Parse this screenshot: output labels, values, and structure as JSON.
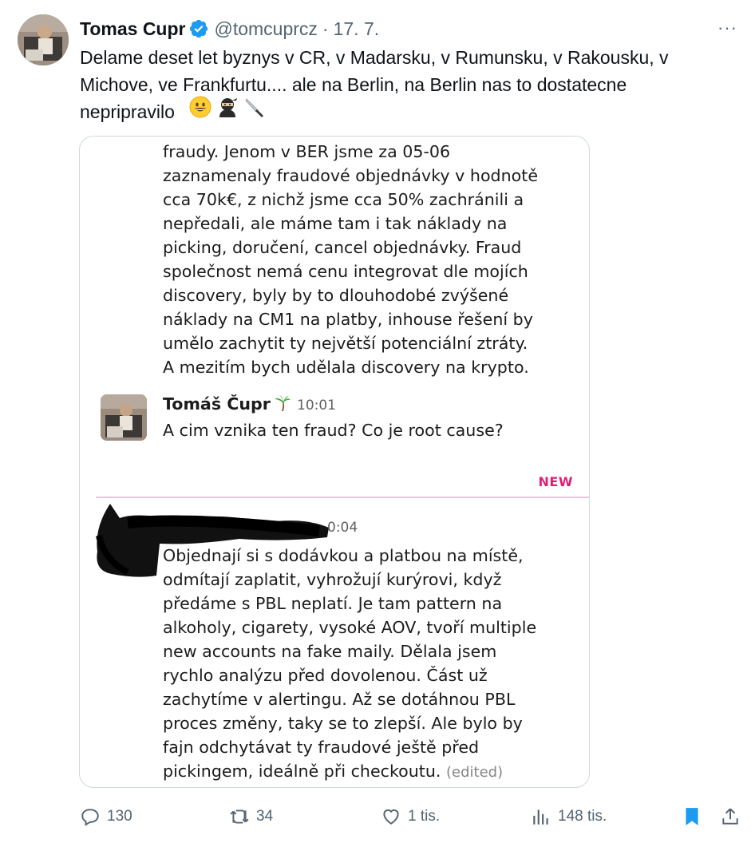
{
  "author": {
    "name": "Tomas Cupr",
    "handle": "@tomcuprcz",
    "separator": "·",
    "date": "17. 7.",
    "verified": true
  },
  "more_label": "···",
  "tweet_text": "Delame deset let byznys v CR, v Madarsku, v Rumunsku, v Rakousku, v Michove, ve Frankfurtu.... ale na Berlin, na Berlin nas to dostatecne nepripravilo",
  "tweet_emojis": [
    "grinning-face-emoji",
    "ninja-emoji",
    "kitchen-knife-emoji"
  ],
  "slack": {
    "first_message_text": "fraudy. Jenom v BER jsme za 05-06\nzaznamenaly fraudové objednávky v hodnotě\ncca 70k€, z nichž jsme cca 50% zachránili a\nnepředali, ale máme tam i tak náklady na\npicking, doručení, cancel objednávky. Fraud\nspolečnost nemá cenu integrovat dle mojích\ndiscovery, byly by to dlouhodobé zvýšené\nnáklady na CM1 na platby, inhouse řešení by\numělo zachytit ty největší potenciální ztráty.\nA mezitím bych udělala discovery na krypto.",
    "reply": {
      "author": "Tomáš Čupr",
      "status_emoji": "palm-tree-emoji",
      "time": "10:01",
      "text": "A cim vznika ten fraud? Co je root cause?"
    },
    "new_label": "NEW",
    "answer": {
      "time_visible": "0:04",
      "text": "Objednají si s dodávkou a platbou na místě,\nodmítají zaplatit, vyhrožují kurýrovi, když\npředáme s PBL neplatí. Je tam pattern na\nalkoholy, cigarety, vysoké AOV, tvoří multiple\nnew accounts na fake maily. Dělala jsem\nrychlo analýzu před dovolenou. Část už\nzachytíme v alertingu. Až se dotáhnou PBL\nproces změny, taky se to zlepší. Ale bylo by\nfajn odchytávat ty fraudové ještě před\npickingem, ideálně při checkoutu. ",
      "edited_label": "(edited)"
    }
  },
  "actions": {
    "replies": "130",
    "reposts": "34",
    "likes": "1 tis.",
    "views": "148 tis."
  },
  "colors": {
    "text": "#0f1419",
    "secondary": "#536471",
    "verified": "#1d9bf0",
    "bookmark": "#1d9bf0",
    "new_marker": "#e01e73",
    "border": "#cfd9de"
  }
}
